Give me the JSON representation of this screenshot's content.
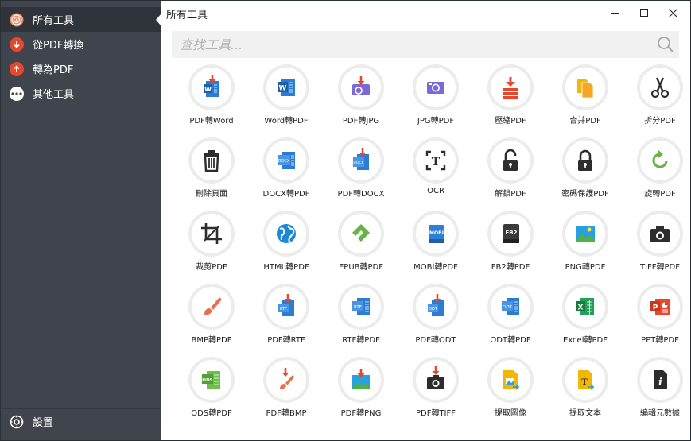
{
  "window": {
    "title": "所有工具",
    "minimize_icon": "minimize-icon",
    "maximize_icon": "maximize-icon",
    "close_icon": "close-icon"
  },
  "sidebar": {
    "items": [
      {
        "label": "所有工具",
        "icon": "target-icon",
        "color": "#e98a6a",
        "active": true
      },
      {
        "label": "從PDF轉換",
        "icon": "arrow-down-icon",
        "color": "#e8472d",
        "active": false
      },
      {
        "label": "轉為PDF",
        "icon": "arrow-up-icon",
        "color": "#e8472d",
        "active": false
      },
      {
        "label": "其他工具",
        "icon": "more-icon",
        "color": "#ffffff",
        "active": false
      }
    ],
    "settings": {
      "label": "設置",
      "icon": "gear-icon"
    }
  },
  "search": {
    "placeholder": "查找工具...",
    "icon": "search-icon"
  },
  "tools": [
    {
      "label": "PDF轉Word",
      "icon": "pdf-to-word-icon"
    },
    {
      "label": "Word轉PDF",
      "icon": "word-to-pdf-icon"
    },
    {
      "label": "PDF轉JPG",
      "icon": "pdf-to-jpg-icon"
    },
    {
      "label": "JPG轉PDF",
      "icon": "jpg-to-pdf-icon"
    },
    {
      "label": "壓縮PDF",
      "icon": "compress-icon"
    },
    {
      "label": "合并PDF",
      "icon": "merge-icon"
    },
    {
      "label": "拆分PDF",
      "icon": "scissors-icon"
    },
    {
      "label": "刪除頁面",
      "icon": "trash-icon"
    },
    {
      "label": "DOCX轉PDF",
      "icon": "docx-to-pdf-icon"
    },
    {
      "label": "PDF轉DOCX",
      "icon": "pdf-to-docx-icon"
    },
    {
      "label": "OCR",
      "icon": "ocr-icon"
    },
    {
      "label": "解鎖PDF",
      "icon": "unlock-icon"
    },
    {
      "label": "密碼保護PDF",
      "icon": "lock-icon"
    },
    {
      "label": "旋轉PDF",
      "icon": "rotate-icon"
    },
    {
      "label": "裁剪PDF",
      "icon": "crop-icon"
    },
    {
      "label": "HTML轉PDF",
      "icon": "globe-icon"
    },
    {
      "label": "EPUB轉PDF",
      "icon": "epub-icon"
    },
    {
      "label": "MOBI轉PDF",
      "icon": "mobi-icon"
    },
    {
      "label": "FB2轉PDF",
      "icon": "fb2-icon"
    },
    {
      "label": "PNG轉PDF",
      "icon": "png-icon"
    },
    {
      "label": "TIFF轉PDF",
      "icon": "camera-icon"
    },
    {
      "label": "BMP轉PDF",
      "icon": "brush-icon"
    },
    {
      "label": "PDF轉RTF",
      "icon": "pdf-to-rtf-icon"
    },
    {
      "label": "RTF轉PDF",
      "icon": "rtf-to-pdf-icon"
    },
    {
      "label": "PDF轉ODT",
      "icon": "pdf-to-odt-icon"
    },
    {
      "label": "ODT轉PDF",
      "icon": "odt-to-pdf-icon"
    },
    {
      "label": "Excel轉PDF",
      "icon": "excel-icon"
    },
    {
      "label": "PPT轉PDF",
      "icon": "ppt-icon"
    },
    {
      "label": "ODS轉PDF",
      "icon": "ods-icon"
    },
    {
      "label": "PDF轉BMP",
      "icon": "pdf-to-bmp-icon"
    },
    {
      "label": "PDF轉PNG",
      "icon": "pdf-to-png-icon"
    },
    {
      "label": "PDF轉TIFF",
      "icon": "pdf-to-tiff-icon"
    },
    {
      "label": "提取圖像",
      "icon": "extract-image-icon"
    },
    {
      "label": "提取文本",
      "icon": "extract-text-icon"
    },
    {
      "label": "編輯元數據",
      "icon": "info-icon"
    }
  ],
  "colors": {
    "sidebar_bg": "#3f444d",
    "sidebar_active": "#2f333a",
    "accent_red": "#e8472d",
    "word_blue": "#2b7cd3",
    "purple": "#7b6ad6",
    "gold": "#f2b705",
    "green": "#67b346"
  }
}
